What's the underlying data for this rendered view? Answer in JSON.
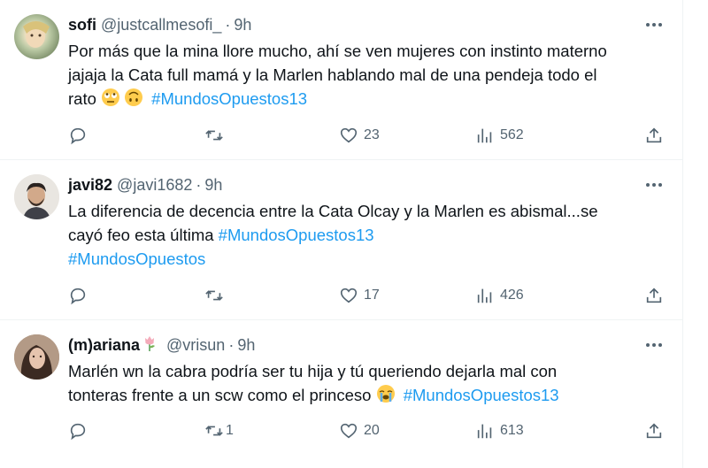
{
  "tweets": [
    {
      "name": "sofi",
      "handle": "@justcallmesofi_",
      "dot": "·",
      "time": "9h",
      "text_lines": [
        "Por más que la mina llore mucho, ahí se ven mujeres con instinto materno",
        "jajaja la Cata full mamá y la Marlen hablando mal de una pendeja todo el"
      ],
      "line3_text": "rato",
      "emojis": [
        "rolling-eyes-emoji",
        "upside-down-face-emoji"
      ],
      "hashtags": [
        "#MundosOpuestos13"
      ],
      "replies": "",
      "retweets": "",
      "likes": "23",
      "views": "562"
    },
    {
      "name": "javi82",
      "handle": "@javi1682",
      "dot": "·",
      "time": "9h",
      "text_lines": [
        "La diferencia de decencia entre la Cata Olcay y la Marlen es abismal...se"
      ],
      "line2_text": "cayó feo esta última",
      "hashtags": [
        "#MundosOpuestos13",
        "#MundosOpuestos"
      ],
      "replies": "",
      "retweets": "",
      "likes": "17",
      "views": "426"
    },
    {
      "name": "(m)ariana",
      "name_emoji": "tulip-emoji",
      "handle": "@vrisun",
      "dot": "·",
      "time": "9h",
      "text_lines": [
        "Marlén wn la cabra podría ser tu hija y tú queriendo dejarla mal con"
      ],
      "line2_text": "tonteras frente a un scw como el princeso",
      "emojis": [
        "loudly-crying-face-emoji"
      ],
      "hashtags": [
        "#MundosOpuestos13"
      ],
      "replies": "",
      "retweets": "1",
      "likes": "20",
      "views": "613"
    }
  ],
  "colors": {
    "accent": "#1d9bf0",
    "text": "#0f1419",
    "secondary": "#536471",
    "border": "#eff3f4"
  }
}
